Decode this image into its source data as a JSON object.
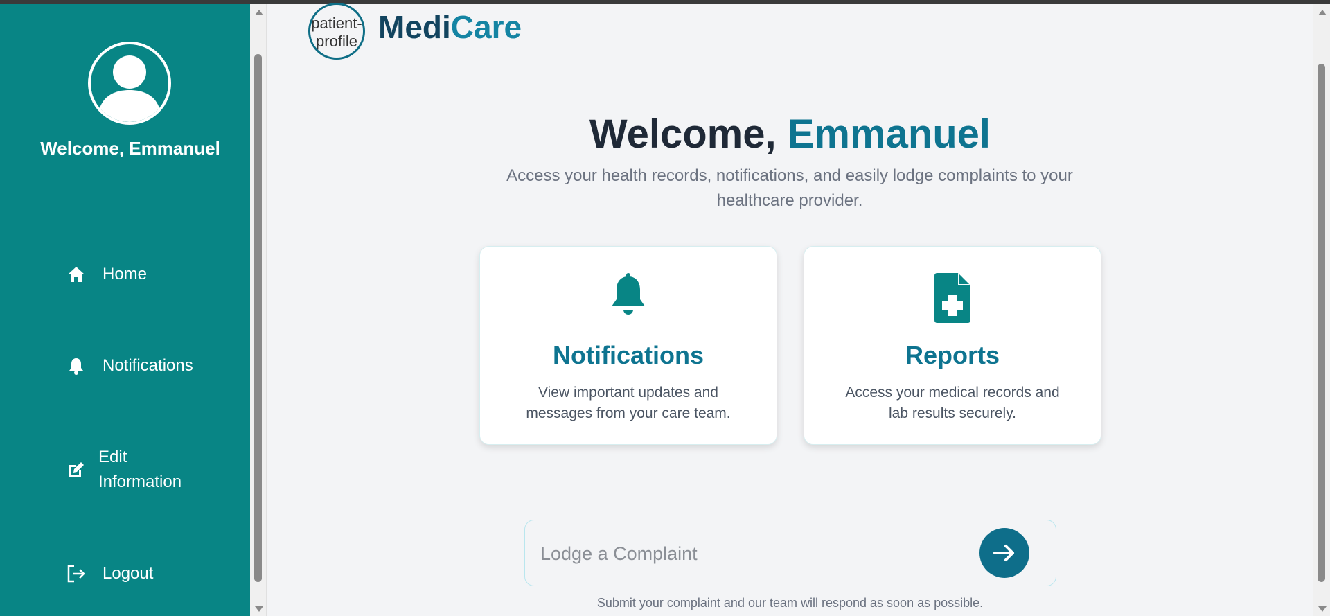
{
  "sidebar": {
    "welcome": "Welcome, Emmanuel",
    "items": [
      {
        "label": "Home",
        "icon": "home-icon"
      },
      {
        "label": "Notifications",
        "icon": "bell-icon"
      },
      {
        "label_line1": "Edit",
        "label_line2": "Information",
        "icon": "edit-icon"
      },
      {
        "label": "Logout",
        "icon": "logout-icon"
      }
    ],
    "color": "#088585"
  },
  "header": {
    "logo_alt": "patient-profile",
    "logo_text": "patient-profile",
    "brand_part1": "Medi",
    "brand_part2": "Care"
  },
  "hero": {
    "title_prefix": "Welcome, ",
    "title_name": "Emmanuel",
    "subtitle": "Access your health records, notifications, and easily lodge complaints to your healthcare provider."
  },
  "cards": [
    {
      "title": "Notifications",
      "description": "View important updates and messages from your care team.",
      "icon": "bell-icon"
    },
    {
      "title": "Reports",
      "description": "Access your medical records and lab results securely.",
      "icon": "medical-file-icon"
    }
  ],
  "complaint": {
    "placeholder": "Lodge a Complaint",
    "value": "",
    "hint": "Submit your complaint and our team will respond as soon as possible."
  },
  "colors": {
    "accent": "#0e7490",
    "brand_dark": "#12445f",
    "button": "#0e6e8a"
  }
}
